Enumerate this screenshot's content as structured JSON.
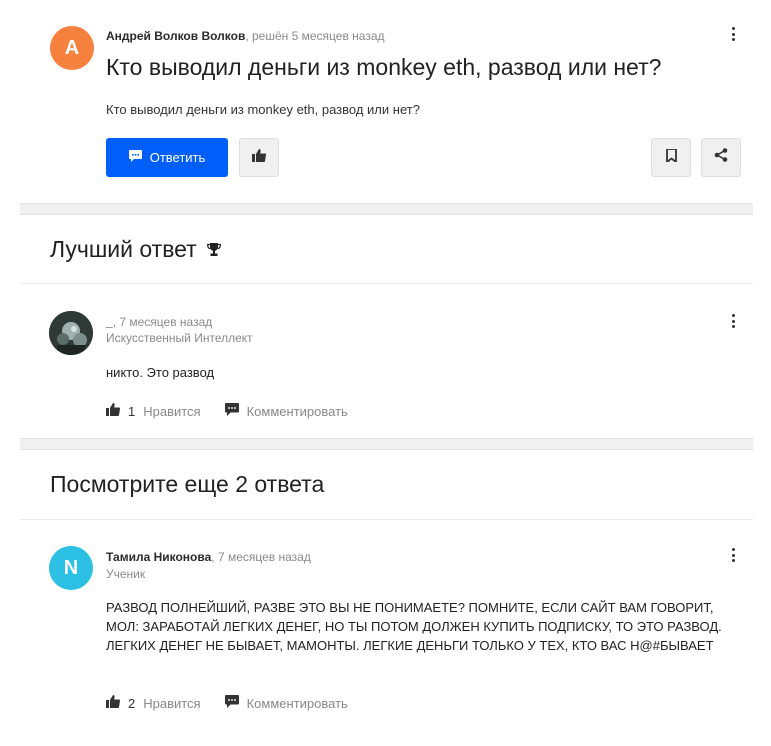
{
  "question": {
    "avatar_letter": "A",
    "avatar_color": "#f5813f",
    "author": "Андрей Волков Волков",
    "meta": ", решён 5 месяцев назад",
    "title": "Кто выводил деньги из monkey eth, развод или нет?",
    "body": "Кто выводил деньги из monkey eth, развод или нет?",
    "reply_label": "Ответить",
    "icons": {
      "reply": "comment-icon",
      "like": "thumbs-up-icon",
      "bookmark": "bookmark-icon",
      "share": "share-icon",
      "more": "kebab-menu-icon"
    }
  },
  "best_answer": {
    "section_title": "Лучший ответ",
    "trophy_icon": "trophy-icon",
    "author": "_",
    "meta": ", 7 месяцев назад",
    "role": "Искусственный Интеллект",
    "text": "никто. Это развод",
    "like_count": "1",
    "like_label": "Нравится",
    "comment_label": "Комментировать"
  },
  "more_answers": {
    "section_title": "Посмотрите еще 2 ответа",
    "answer": {
      "avatar_letter": "N",
      "avatar_color": "#2bc0e4",
      "author": "Тамила Никонова",
      "meta": ", 7 месяцев назад",
      "role": "Ученик",
      "text": "РАЗВОД ПОЛНЕЙШИЙ, РАЗВЕ ЭТО ВЫ НЕ ПОНИМАЕТЕ? ПОМНИТЕ, ЕСЛИ САЙТ ВАМ ГОВОРИТ, МОЛ: ЗАРАБОТАЙ ЛЕГКИХ ДЕНЕГ, НО ТЫ ПОТОМ ДОЛЖЕН КУПИТЬ ПОДПИСКУ, ТО ЭТО РАЗВОД. ЛЕГКИХ ДЕНЕГ НЕ БЫВАЕТ, МАМОНТЫ. ЛЕГКИЕ ДЕНЬГИ ТОЛЬКО У ТЕХ, КТО ВАС Н@#БЫВАЕТ",
      "like_count": "2",
      "like_label": "Нравится",
      "comment_label": "Комментировать"
    }
  }
}
